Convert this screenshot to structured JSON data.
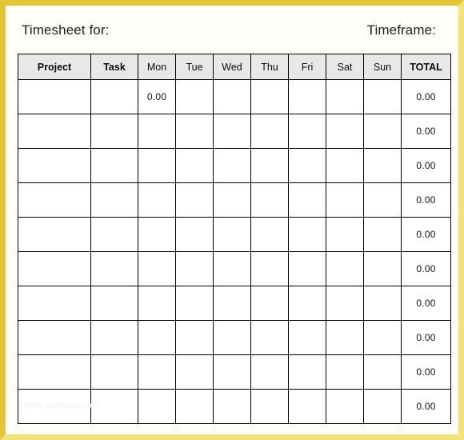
{
  "document": {
    "heading_left": "Timesheet for:",
    "heading_right": "Timeframe:",
    "watermark": "www.template.net",
    "frame_color": "#e3c634",
    "header_row_bg": "#e8e8e8"
  },
  "table": {
    "columns": [
      {
        "label": "Project",
        "key": "project",
        "emphasis": "bold"
      },
      {
        "label": "Task",
        "key": "task",
        "emphasis": "bold"
      },
      {
        "label": "Mon",
        "key": "mon",
        "emphasis": "normal"
      },
      {
        "label": "Tue",
        "key": "tue",
        "emphasis": "normal"
      },
      {
        "label": "Wed",
        "key": "wed",
        "emphasis": "normal"
      },
      {
        "label": "Thu",
        "key": "thu",
        "emphasis": "normal"
      },
      {
        "label": "Fri",
        "key": "fri",
        "emphasis": "normal"
      },
      {
        "label": "Sat",
        "key": "sat",
        "emphasis": "normal"
      },
      {
        "label": "Sun",
        "key": "sun",
        "emphasis": "normal"
      },
      {
        "label": "TOTAL",
        "key": "total",
        "emphasis": "bold"
      }
    ],
    "rows": [
      {
        "project": "",
        "task": "",
        "mon": "0.00",
        "tue": "",
        "wed": "",
        "thu": "",
        "fri": "",
        "sat": "",
        "sun": "",
        "total": "0.00"
      },
      {
        "project": "",
        "task": "",
        "mon": "",
        "tue": "",
        "wed": "",
        "thu": "",
        "fri": "",
        "sat": "",
        "sun": "",
        "total": "0.00"
      },
      {
        "project": "",
        "task": "",
        "mon": "",
        "tue": "",
        "wed": "",
        "thu": "",
        "fri": "",
        "sat": "",
        "sun": "",
        "total": "0.00"
      },
      {
        "project": "",
        "task": "",
        "mon": "",
        "tue": "",
        "wed": "",
        "thu": "",
        "fri": "",
        "sat": "",
        "sun": "",
        "total": "0.00"
      },
      {
        "project": "",
        "task": "",
        "mon": "",
        "tue": "",
        "wed": "",
        "thu": "",
        "fri": "",
        "sat": "",
        "sun": "",
        "total": "0.00"
      },
      {
        "project": "",
        "task": "",
        "mon": "",
        "tue": "",
        "wed": "",
        "thu": "",
        "fri": "",
        "sat": "",
        "sun": "",
        "total": "0.00"
      },
      {
        "project": "",
        "task": "",
        "mon": "",
        "tue": "",
        "wed": "",
        "thu": "",
        "fri": "",
        "sat": "",
        "sun": "",
        "total": "0.00"
      },
      {
        "project": "",
        "task": "",
        "mon": "",
        "tue": "",
        "wed": "",
        "thu": "",
        "fri": "",
        "sat": "",
        "sun": "",
        "total": "0.00"
      },
      {
        "project": "",
        "task": "",
        "mon": "",
        "tue": "",
        "wed": "",
        "thu": "",
        "fri": "",
        "sat": "",
        "sun": "",
        "total": "0.00"
      },
      {
        "project": "",
        "task": "",
        "mon": "",
        "tue": "",
        "wed": "",
        "thu": "",
        "fri": "",
        "sat": "",
        "sun": "",
        "total": "0.00"
      }
    ]
  }
}
